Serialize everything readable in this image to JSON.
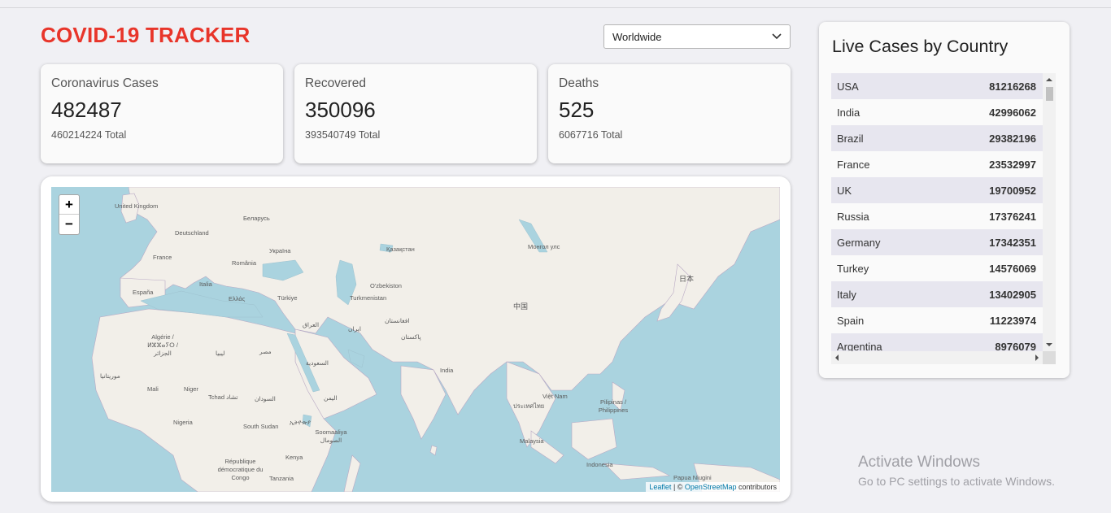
{
  "header": {
    "title": "COVID-19 TRACKER"
  },
  "country_select": {
    "value": "Worldwide"
  },
  "colors": {
    "title": "#e8352a",
    "water": "#aad3df",
    "land": "#f2efe9",
    "row_odd": "#e7e6ef"
  },
  "cards": [
    {
      "title": "Coronavirus Cases",
      "number": "482487",
      "total": "460214224 Total"
    },
    {
      "title": "Recovered",
      "number": "350096",
      "total": "393540749 Total"
    },
    {
      "title": "Deaths",
      "number": "525",
      "total": "6067716 Total"
    }
  ],
  "map": {
    "zoom_in": "+",
    "zoom_out": "−",
    "attribution": {
      "leaflet": "Leaflet",
      "sep": " | © ",
      "osm": "OpenStreetMap",
      "suffix": " contributors"
    },
    "labels": [
      "United Kingdom",
      "Беларусь",
      "Deutschland",
      "Україна",
      "France",
      "România",
      "Қазақстан",
      "Монгол улс",
      "Italia",
      "España",
      "Türkiye",
      "Ελλάς",
      "O'zbekiston",
      "Turkmenistan",
      "日本",
      "中国",
      "العراق",
      "ایران",
      "افغانستان",
      "پاکستان",
      "Algérie / ⵍⵣⵣⴰⵢⵔ / الجزائر",
      "ليبيا",
      "مصر",
      "السعودية",
      "India",
      "موريتانيا",
      "Mali",
      "Niger",
      "Tchad تشاد",
      "السودان",
      "اليمن",
      "Việt Nam",
      "Pilipinas / Philippines",
      "Nigeria",
      "South Sudan",
      "ኢትዮጵያ",
      "Soomaaliya الصومال",
      "Malaysia",
      "Kenya",
      "République démocratique du Congo",
      "Tanzania",
      "Indonesia",
      "Papua Niugini",
      "ประเทศไทย"
    ]
  },
  "live_cases": {
    "title": "Live Cases by Country",
    "rows": [
      {
        "country": "USA",
        "cases": "81216268"
      },
      {
        "country": "India",
        "cases": "42996062"
      },
      {
        "country": "Brazil",
        "cases": "29382196"
      },
      {
        "country": "France",
        "cases": "23532997"
      },
      {
        "country": "UK",
        "cases": "19700952"
      },
      {
        "country": "Russia",
        "cases": "17376241"
      },
      {
        "country": "Germany",
        "cases": "17342351"
      },
      {
        "country": "Turkey",
        "cases": "14576069"
      },
      {
        "country": "Italy",
        "cases": "13402905"
      },
      {
        "country": "Spain",
        "cases": "11223974"
      },
      {
        "country": "Argentina",
        "cases": "8976079"
      }
    ]
  },
  "watermark": {
    "line1": "Activate Windows",
    "line2": "Go to PC settings to activate Windows."
  }
}
